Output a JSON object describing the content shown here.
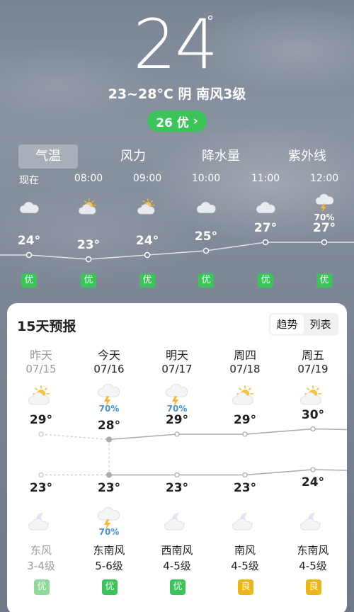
{
  "current": {
    "temperature": "24",
    "degree_symbol": "°",
    "summary": "23~28°C 阴 南风3级",
    "aqi_label": "26 优",
    "aqi_arrow": "›"
  },
  "tabs": [
    "气温",
    "风力",
    "降水量",
    "紫外线"
  ],
  "active_tab": 0,
  "hourly": [
    {
      "time": "现在",
      "icon": "cloudy-icon",
      "temp": "24°",
      "aqi": "优",
      "temp_value": 24
    },
    {
      "time": "08:00",
      "icon": "partly-cloudy-icon",
      "temp": "23°",
      "aqi": "优",
      "temp_value": 23
    },
    {
      "time": "09:00",
      "icon": "partly-cloudy-icon",
      "temp": "24°",
      "aqi": "优",
      "temp_value": 24
    },
    {
      "time": "10:00",
      "icon": "cloudy-icon",
      "temp": "25°",
      "aqi": "优",
      "temp_value": 25
    },
    {
      "time": "11:00",
      "icon": "cloudy-icon",
      "temp": "27°",
      "aqi": "优",
      "temp_value": 27
    },
    {
      "time": "12:00",
      "icon": "thunderstorm-icon",
      "pop": "70%",
      "temp": "27°",
      "aqi": "优",
      "temp_value": 27
    }
  ],
  "forecast": {
    "title": "15天预报",
    "toggle": [
      "趋势",
      "列表"
    ],
    "days": [
      {
        "name": "昨天",
        "date": "07/15",
        "icon": "partly-cloudy-icon",
        "hi": "29°",
        "lo": "23°",
        "hi_value": 29,
        "lo_value": 23,
        "night_icon": "moon-cloud-icon",
        "wind": "东风",
        "level": "3-4级",
        "aqi": "优",
        "aqi_color": "#8fd99a",
        "past": true
      },
      {
        "name": "今天",
        "date": "07/16",
        "icon": "thunderstorm-icon",
        "pop": "70%",
        "hi": "28°",
        "lo": "23°",
        "hi_value": 28,
        "lo_value": 23,
        "night_icon": "thunderstorm-icon",
        "night_pop": "70%",
        "wind": "东南风",
        "level": "5-6级",
        "aqi": "优",
        "aqi_color": "#3bc45a"
      },
      {
        "name": "明天",
        "date": "07/17",
        "icon": "thunderstorm-icon",
        "pop": "70%",
        "hi": "29°",
        "lo": "23°",
        "hi_value": 29,
        "lo_value": 23,
        "night_icon": "moon-cloud-icon",
        "wind": "西南风",
        "level": "4-5级",
        "aqi": "优",
        "aqi_color": "#3bc45a"
      },
      {
        "name": "周四",
        "date": "07/18",
        "icon": "partly-cloudy-icon",
        "hi": "29°",
        "lo": "23°",
        "hi_value": 29,
        "lo_value": 23,
        "night_icon": "moon-cloud-icon",
        "wind": "南风",
        "level": "4-5级",
        "aqi": "良",
        "aqi_color": "#f0b51a"
      },
      {
        "name": "周五",
        "date": "07/19",
        "icon": "partly-cloudy-icon",
        "hi": "30°",
        "lo": "24°",
        "hi_value": 30,
        "lo_value": 24,
        "night_icon": "moon-cloud-icon",
        "wind": "东南风",
        "level": "4-5级",
        "aqi": "良",
        "aqi_color": "#f0b51a"
      }
    ]
  },
  "colors": {
    "aqi_good": "#3bc45a",
    "aqi_moderate": "#f0b51a",
    "rain": "#4f8fe3"
  }
}
